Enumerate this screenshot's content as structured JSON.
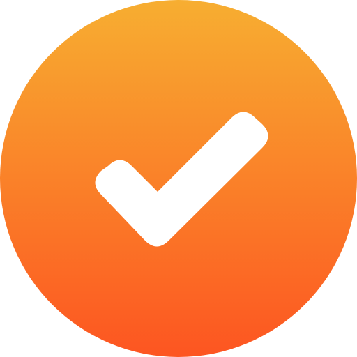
{
  "icon": {
    "name": "checkmark-circle-icon",
    "colors": {
      "gradient_top": "#F7AE31",
      "gradient_bottom": "#FD5521",
      "check": "#FFFFFF",
      "background": "#FFFFFF"
    }
  }
}
